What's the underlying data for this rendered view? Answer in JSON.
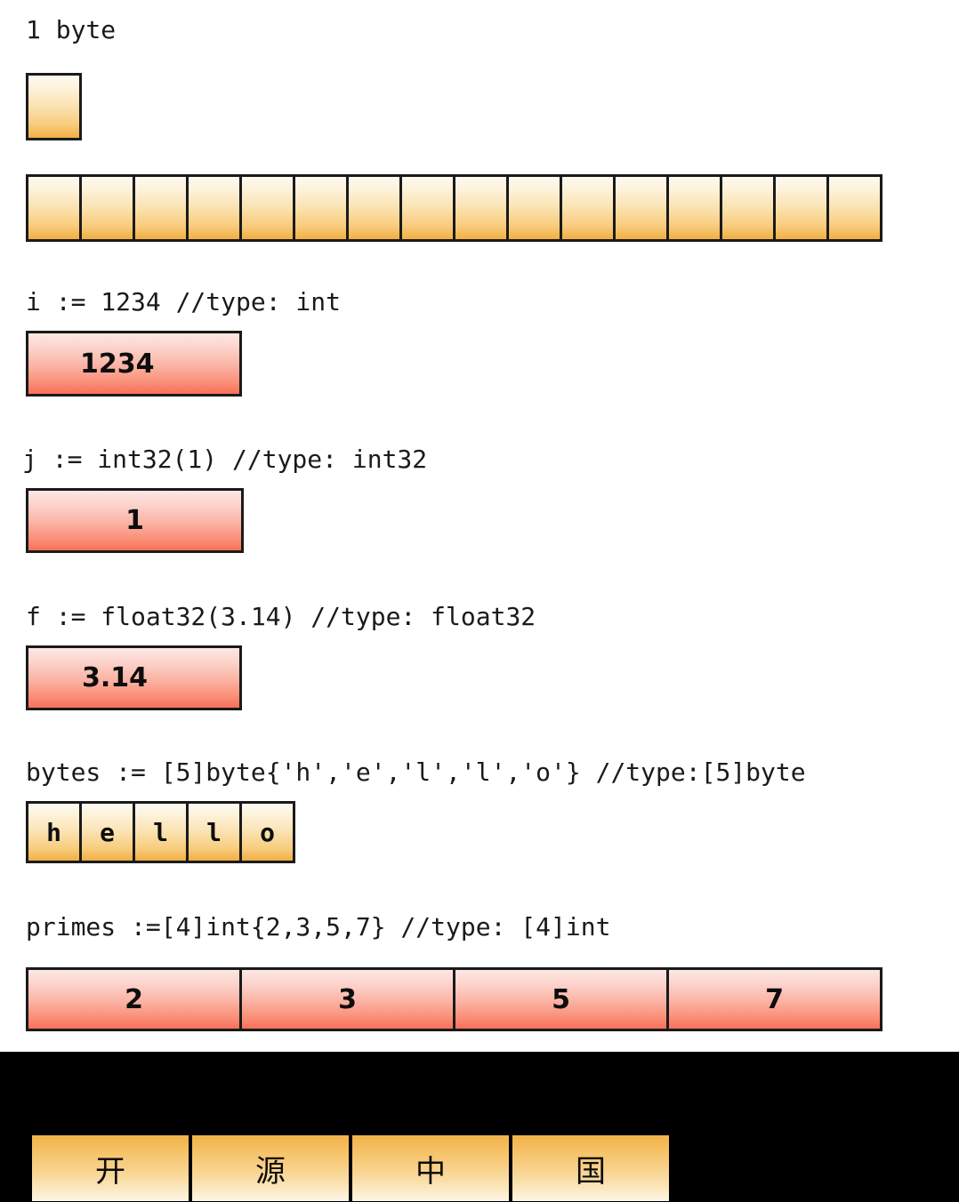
{
  "colors": {
    "background": "#ffffff",
    "band": "#000000",
    "border": "#1a1a1a",
    "orange_top": "#fdfaf0",
    "orange_bottom": "#f2ae45",
    "red_top": "#fde7e3",
    "red_bottom": "#f8705a",
    "text": "#1a1a1a"
  },
  "sections": {
    "byte_label": "1 byte",
    "int_code": "i := 1234 //type: int",
    "int32_code": "j := int32(1) //type: int32",
    "float32_code": "f := float32(3.14) //type: float32",
    "bytes_code": "bytes := [5]byte{'h','e','l','l','o'} //type:[5]byte",
    "primes_code": "primes :=[4]int{2,3,5,7} //type: [4]int"
  },
  "single_byte": {
    "count": 1,
    "cells": [
      ""
    ]
  },
  "byte_strip": {
    "count": 16,
    "cells": [
      "",
      "",
      "",
      "",
      "",
      "",
      "",
      "",
      "",
      "",
      "",
      "",
      "",
      "",
      "",
      ""
    ]
  },
  "int_value": {
    "cells": [
      "1234"
    ]
  },
  "int32_value": {
    "cells": [
      "1"
    ]
  },
  "float32_value": {
    "cells": [
      "3.14"
    ]
  },
  "bytes_value": {
    "cells": [
      "h",
      "e",
      "l",
      "l",
      "o"
    ]
  },
  "primes_value": {
    "cells": [
      "2",
      "3",
      "5",
      "7"
    ]
  },
  "cjk_value": {
    "cells": [
      "开",
      "源",
      "中",
      "国"
    ]
  }
}
